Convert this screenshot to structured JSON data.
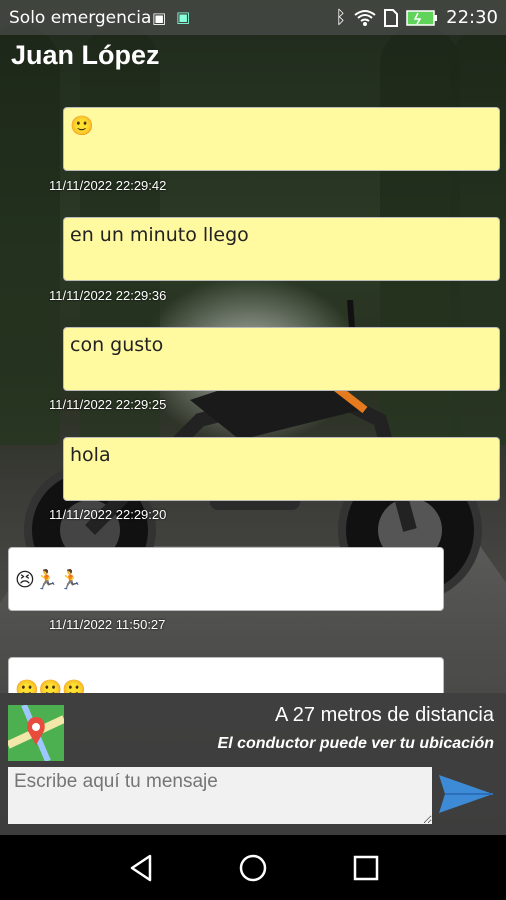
{
  "status_bar": {
    "carrier": "Solo emergencia",
    "time": "22:30"
  },
  "chat": {
    "contact_name": "Juan López",
    "messages": [
      {
        "text": "🙂",
        "timestamp": "11/11/2022 22:29:42",
        "side": "sent"
      },
      {
        "text": "en un minuto llego",
        "timestamp": "11/11/2022 22:29:36",
        "side": "sent"
      },
      {
        "text": "con gusto",
        "timestamp": "11/11/2022 22:29:25",
        "side": "sent"
      },
      {
        "text": "hola",
        "timestamp": "11/11/2022 22:29:20",
        "side": "sent"
      },
      {
        "text": "😣🏃🏃",
        "timestamp": "11/11/2022 11:50:27",
        "side": "received"
      },
      {
        "text": "🙂🙂🙂",
        "timestamp": "",
        "side": "received"
      }
    ]
  },
  "location": {
    "distance": "A 27 metros de distancia",
    "notice": "El conductor puede ver tu ubicación"
  },
  "composer": {
    "placeholder": "Escribe aquí tu mensaje"
  },
  "colors": {
    "sent_bubble": "#fff9a0",
    "received_bubble": "#ffffff",
    "send_icon": "#3d8ad6"
  },
  "icons": [
    "bluetooth-icon",
    "wifi-icon",
    "sim-icon",
    "battery-icon",
    "map-icon",
    "send-icon",
    "back-icon",
    "home-icon",
    "recents-icon"
  ]
}
